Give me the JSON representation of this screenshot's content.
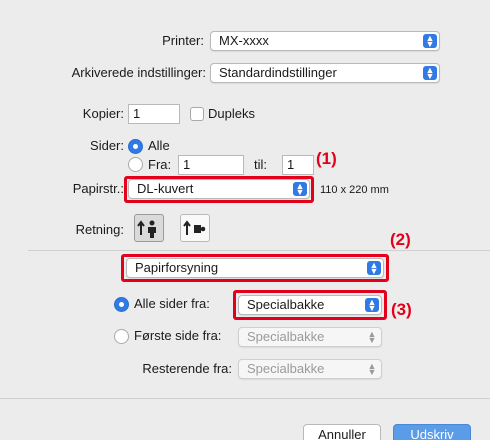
{
  "printer": {
    "label": "Printer:",
    "value": "MX-xxxx"
  },
  "presets": {
    "label": "Arkiverede indstillinger:",
    "value": "Standardindstillinger"
  },
  "copies": {
    "label": "Kopier:",
    "value": "1",
    "duplex_label": "Dupleks"
  },
  "pages": {
    "label": "Sider:",
    "all_label": "Alle",
    "from_label": "Fra:",
    "from_value": "1",
    "to_label": "til:",
    "to_value": "1"
  },
  "paper_size": {
    "label": "Papirstr.:",
    "value": "DL-kuvert",
    "dimensions": "110 x 220 mm"
  },
  "orientation": {
    "label": "Retning:"
  },
  "section_popup": {
    "value": "Papirforsyning"
  },
  "paper_feed": {
    "all_pages_label": "Alle sider fra:",
    "all_pages_value": "Specialbakke",
    "first_page_label": "Første side fra:",
    "first_page_value": "Specialbakke",
    "remaining_label": "Resterende fra:",
    "remaining_value": "Specialbakke"
  },
  "callouts": {
    "c1": "(1)",
    "c2": "(2)",
    "c3": "(3)"
  },
  "buttons": {
    "cancel": "Annuller",
    "print": "Udskriv"
  },
  "colors": {
    "accent": "#2f7ae5",
    "callout": "#e2001a",
    "primary_button": "#5b9ce9"
  }
}
